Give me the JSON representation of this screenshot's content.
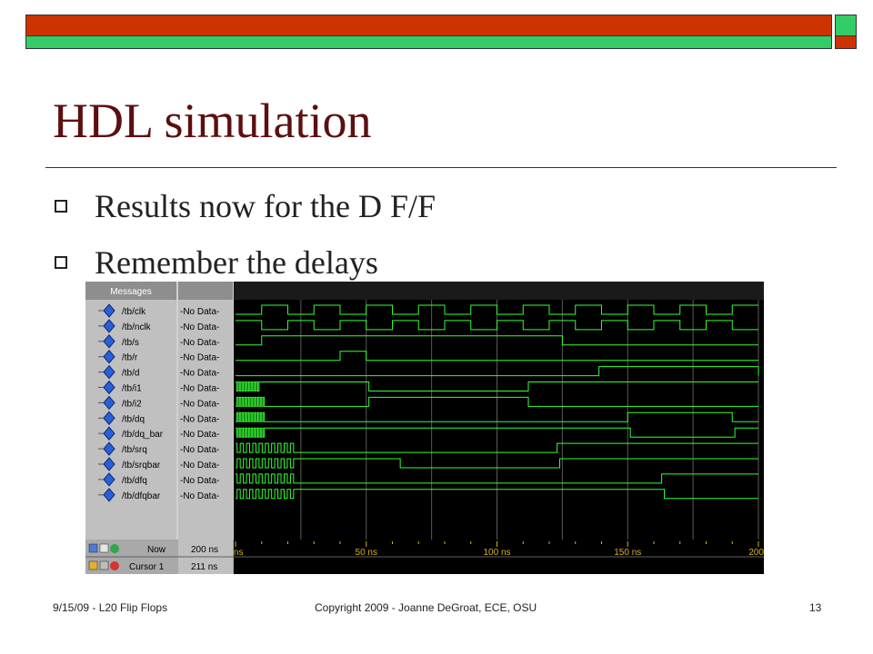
{
  "slide": {
    "title": "HDL simulation",
    "bullets": [
      "Results now for the D F/F",
      "Remember the delays"
    ],
    "footer_left": "9/15/09 - L20 Flip Flops",
    "footer_center": "Copyright 2009 - Joanne DeGroat, ECE, OSU",
    "page_number": "13"
  },
  "colors": {
    "title": "#5c0f0f",
    "bar_red": "#cc3300",
    "bar_green": "#33cc66",
    "wave": "#33ff33"
  },
  "waveform_window": {
    "messages_header": "Messages",
    "signals": [
      {
        "name": "/tb/clk",
        "value": "-No Data-"
      },
      {
        "name": "/tb/nclk",
        "value": "-No Data-"
      },
      {
        "name": "/tb/s",
        "value": "-No Data-"
      },
      {
        "name": "/tb/r",
        "value": "-No Data-"
      },
      {
        "name": "/tb/d",
        "value": "-No Data-"
      },
      {
        "name": "/tb/i1",
        "value": "-No Data-"
      },
      {
        "name": "/tb/i2",
        "value": "-No Data-"
      },
      {
        "name": "/tb/dq",
        "value": "-No Data-"
      },
      {
        "name": "/tb/dq_bar",
        "value": "-No Data-"
      },
      {
        "name": "/tb/srq",
        "value": "-No Data-"
      },
      {
        "name": "/tb/srqbar",
        "value": "-No Data-"
      },
      {
        "name": "/tb/dfq",
        "value": "-No Data-"
      },
      {
        "name": "/tb/dfqbar",
        "value": "-No Data-"
      }
    ],
    "now_label": "Now",
    "now_value": "200 ns",
    "cursor_label": "Cursor 1",
    "cursor_value": "211 ns",
    "timeline_ticks": [
      "ns",
      "50 ns",
      "100 ns",
      "150 ns",
      "200"
    ],
    "time_span_ns": 200
  }
}
